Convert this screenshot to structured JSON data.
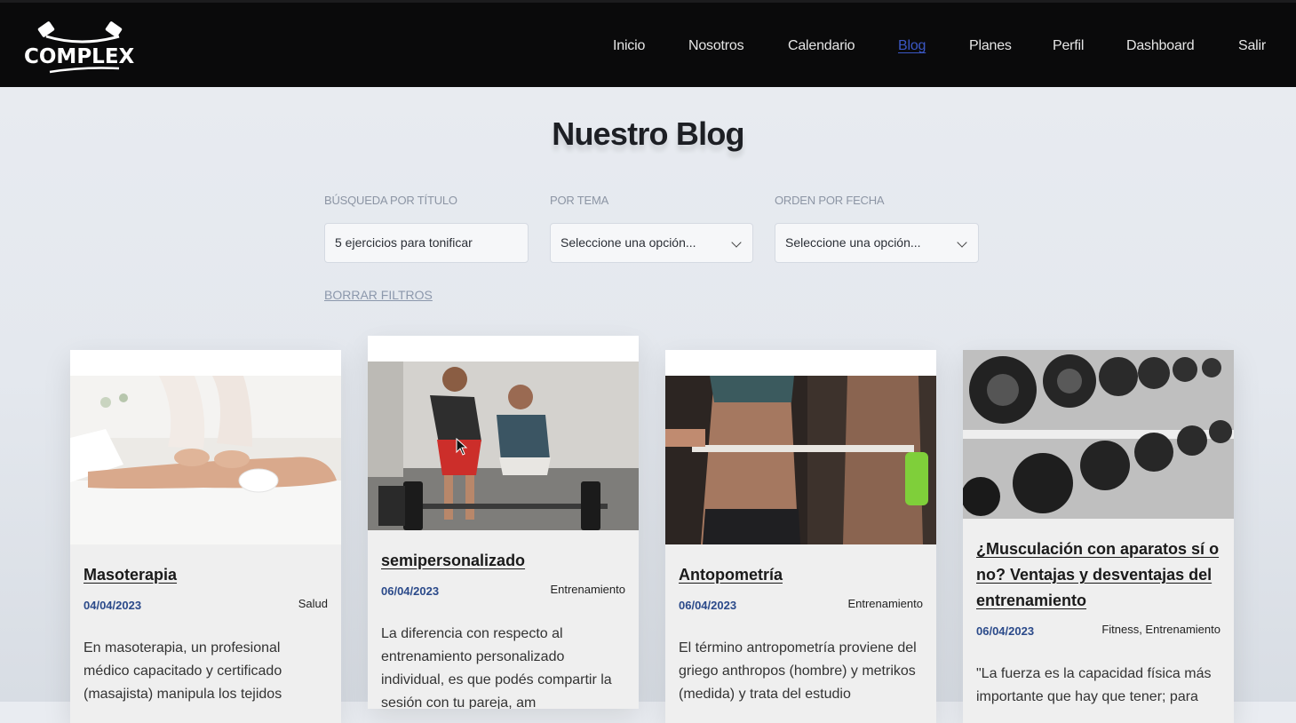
{
  "brand": {
    "name": "COMPLEX"
  },
  "nav": {
    "items": [
      {
        "label": "Inicio",
        "active": false
      },
      {
        "label": "Nosotros",
        "active": false
      },
      {
        "label": "Calendario",
        "active": false
      },
      {
        "label": "Blog",
        "active": true
      },
      {
        "label": "Planes",
        "active": false
      },
      {
        "label": "Perfil",
        "active": false
      },
      {
        "label": "Dashboard",
        "active": false
      },
      {
        "label": "Salir",
        "active": false
      }
    ]
  },
  "page": {
    "title": "Nuestro Blog"
  },
  "filters": {
    "title_label": "BÚSQUEDA POR TÍTULO",
    "title_value": "5 ejercicios para tonificar",
    "topic_label": "POR TEMA",
    "topic_value": "Seleccione una opción...",
    "date_label": "ORDEN POR FECHA",
    "date_value": "Seleccione una opción...",
    "clear_label": "BORRAR FILTROS"
  },
  "posts": [
    {
      "title": "Masoterapia",
      "date": "04/04/2023",
      "tags": "Salud",
      "excerpt": "En masoterapia, un profesional médico capacitado y certificado (masajista) manipula los tejidos",
      "image": "massage-photo"
    },
    {
      "title": "semipersonalizado",
      "date": "06/04/2023",
      "tags": "Entrenamiento",
      "excerpt": "La diferencia con respecto al entrenamiento personalizado individual, es que podés compartir la sesión con tu pareja, am",
      "image": "trainer-deadlift-photo"
    },
    {
      "title": "Antopometría",
      "date": "06/04/2023",
      "tags": "Entrenamiento",
      "excerpt": "El término antropometría proviene del griego anthropos (hombre) y metrikos (medida) y trata del estudio",
      "image": "waist-measuring-photo"
    },
    {
      "title": "¿Musculación con aparatos sí o no? Ventajas y desventajas del entrenamiento",
      "date": "06/04/2023",
      "tags": "Fitness, Entrenamiento",
      "excerpt": "\"La fuerza es la capacidad física más importante que hay que tener; para",
      "image": "dumbbell-rack-photo"
    }
  ],
  "colors": {
    "navbar": "#0a0a0b",
    "accent": "#3b57c4",
    "date": "#2b4a8a"
  }
}
